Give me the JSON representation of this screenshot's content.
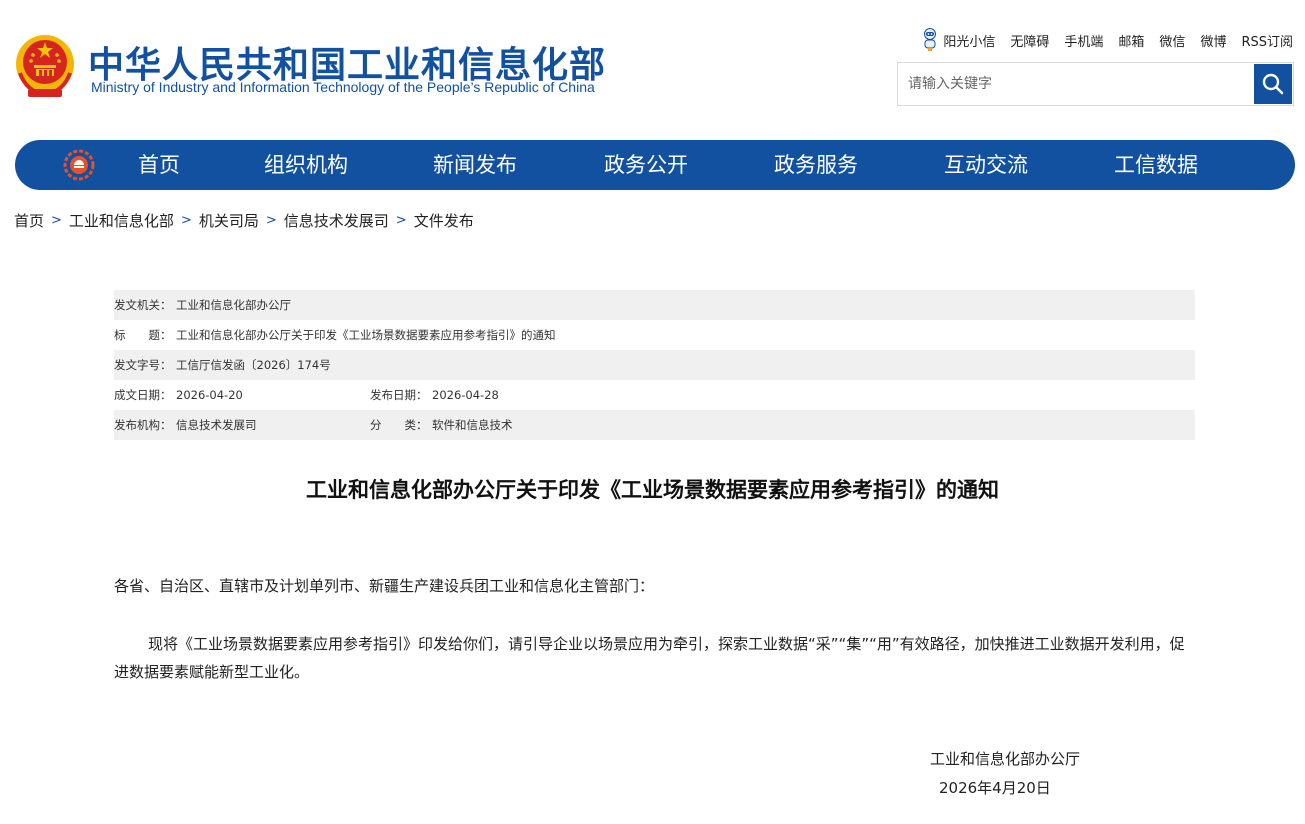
{
  "header": {
    "site_title": "中华人民共和国工业和信息化部",
    "site_subtitle": "Ministry of Industry and Information Technology of the People’s Republic of China",
    "emblem_icon": "national-emblem-icon"
  },
  "toplinks": [
    {
      "label": "阳光小信",
      "icon": "robot-icon"
    },
    {
      "label": "无障碍"
    },
    {
      "label": "手机端"
    },
    {
      "label": "邮箱"
    },
    {
      "label": "微信"
    },
    {
      "label": "微博"
    },
    {
      "label": "RSS订阅"
    }
  ],
  "search": {
    "placeholder": "请输入关键字",
    "value": "",
    "button_icon": "search-icon"
  },
  "nav": {
    "logo_icon": "ministry-logo-icon",
    "items": [
      "首页",
      "组织机构",
      "新闻发布",
      "政务公开",
      "政务服务",
      "互动交流",
      "工信数据"
    ]
  },
  "breadcrumb": [
    "首页",
    "工业和信息化部",
    "机关司局",
    "信息技术发展司",
    "文件发布"
  ],
  "breadcrumb_sep": ">",
  "meta": {
    "issuer_label": "发文机关：",
    "issuer": "工业和信息化部办公厅",
    "title_label": "标　　题：",
    "title": "工业和信息化部办公厅关于印发《工业场景数据要素应用参考指引》的通知",
    "doc_no_label": "发文字号：",
    "doc_no": "工信厅信发函〔2026〕174号",
    "created_label": "成文日期：",
    "created": "2026-04-20",
    "published_label": "发布日期：",
    "published": "2026-04-28",
    "org_label": "发布机构：",
    "org": "信息技术发展司",
    "category_label": "分　　类：",
    "category": "软件和信息技术"
  },
  "document": {
    "title": "工业和信息化部办公厅关于印发《工业场景数据要素应用参考指引》的通知",
    "salutation": "各省、自治区、直辖市及计划单列市、新疆生产建设兵团工业和信息化主管部门：",
    "body": "现将《工业场景数据要素应用参考指引》印发给你们，请引导企业以场景应用为牵引，探索工业数据“采”“集”“用”有效路径，加快推进工业数据开发利用，促进数据要素赋能新型工业化。",
    "signature_org": "工业和信息化部办公厅",
    "signature_date": "2026年4月20日"
  },
  "colors": {
    "brand_blue": "#1250a0",
    "row_shade": "#f0f0f0",
    "emblem_red": "#d6241f",
    "emblem_gold": "#f5c400"
  }
}
